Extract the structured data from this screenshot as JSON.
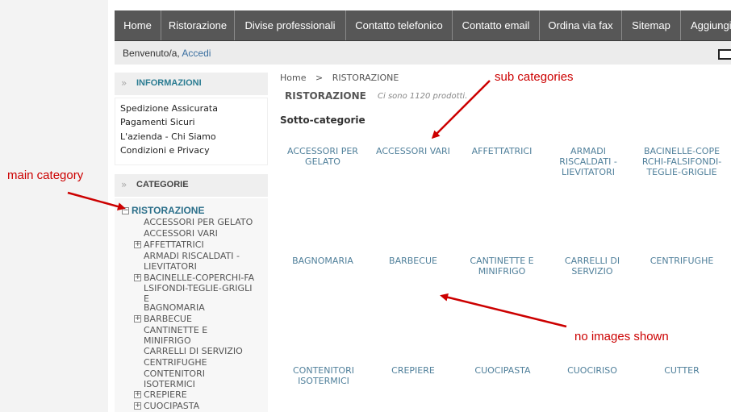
{
  "nav": {
    "items": [
      "Home",
      "Ristorazione",
      "Divise professionali",
      "Contatto telefonico",
      "Contatto email",
      "Ordina via fax",
      "Sitemap",
      "Aggiungi"
    ]
  },
  "welcome": {
    "prefix": "Benvenuto/a,",
    "login": "Accedi"
  },
  "sidebar": {
    "info_title": "INFORMAZIONI",
    "info_links": [
      "Spedizione Assicurata",
      "Pagamenti Sicuri",
      "L'azienda - Chi Siamo",
      "Condizioni e Privacy"
    ],
    "cat_title": "CATEGORIE",
    "main_category": "RISTORAZIONE",
    "tree": [
      "ACCESSORI PER GELATO",
      "ACCESSORI VARI",
      "AFFETTATRICI",
      "ARMADI RISCALDATI - LIEVITATORI",
      "BACINELLE-COPERCHI-FALSIFONDI-TEGLIE-GRIGLIE",
      "BAGNOMARIA",
      "BARBECUE",
      "CANTINETTE E MINIFRIGO",
      "CARRELLI DI SERVIZIO",
      "CENTRIFUGHE",
      "CONTENITORI ISOTERMICI",
      "CREPIERE",
      "CUOCIPASTA"
    ]
  },
  "main": {
    "breadcrumb": [
      "Home",
      ">",
      "RISTORAZIONE"
    ],
    "heading": "RISTORAZIONE",
    "count": "Ci sono 1120 prodotti.",
    "subcat_title": "Sotto-categorie",
    "subcategories": [
      "ACCESSORI PER GELATO",
      "ACCESSORI VARI",
      "AFFETTATRICI",
      "ARMADI RISCALDATI - LIEVITATORI",
      "BACINELLE-COPERCHI-FALSIFONDI-TEGLIE-GRIGLIE",
      "BAGNOMARIA",
      "BARBECUE",
      "CANTINETTE E MINIFRIGO",
      "CARRELLI DI SERVIZIO",
      "CENTRIFUGHE",
      "CONTENITORI ISOTERMICI",
      "CREPIERE",
      "CUOCIPASTA",
      "CUOCIRISO",
      "CUTTER"
    ]
  },
  "annotations": {
    "sub": "sub categories",
    "main": "main category",
    "noimg": "no images shown",
    "color": "#cc0000"
  },
  "colors": {
    "nav_bg": "#575757",
    "link": "#2b6f8a",
    "subcat": "#4f7f9a"
  }
}
